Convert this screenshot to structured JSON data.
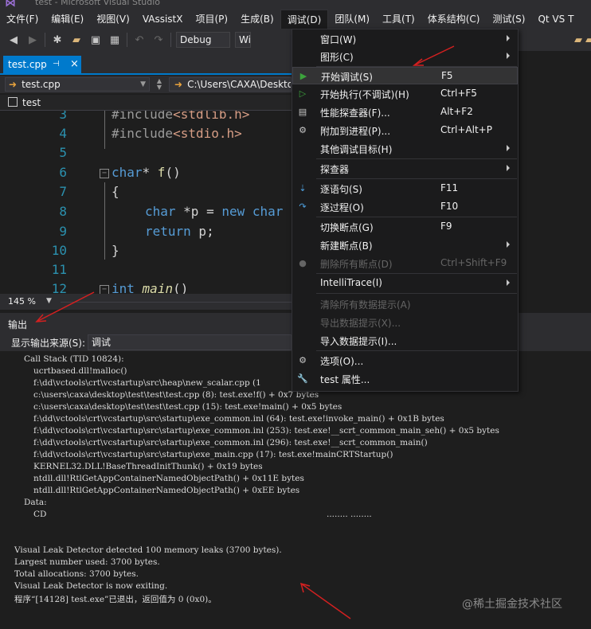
{
  "window": {
    "title": "test - Microsoft Visual Studio"
  },
  "menubar": {
    "items": [
      "文件(F)",
      "编辑(E)",
      "视图(V)",
      "VAssistX",
      "项目(P)",
      "生成(B)",
      "调试(D)",
      "团队(M)",
      "工具(T)",
      "体系结构(C)",
      "测试(S)",
      "Qt VS T"
    ]
  },
  "toolbar": {
    "config": "Debug",
    "platform": "Wi"
  },
  "doc_tab": {
    "label": "test.cpp"
  },
  "navbar": {
    "file": "test.cpp",
    "path": "C:\\Users\\CAXA\\Deskto"
  },
  "scope": {
    "label": "test"
  },
  "editor": {
    "zoom": "145 %",
    "lines": [
      {
        "num": "3",
        "pp": "#include",
        "arg": "<stdlib.h>"
      },
      {
        "num": "4",
        "pp": "#include",
        "arg": "<stdio.h>"
      },
      {
        "num": "5"
      },
      {
        "num": "6",
        "kw": "char",
        "rest": "* ",
        "fn": "f",
        "tail": "()"
      },
      {
        "num": "7",
        "text": "{"
      },
      {
        "num": "8",
        "kw": "char",
        "rest": " *p = ",
        "kw2": "new",
        "tail": " char"
      },
      {
        "num": "9",
        "kw": "return",
        "rest": " p;"
      },
      {
        "num": "10",
        "text": "}"
      },
      {
        "num": "11"
      },
      {
        "num": "12",
        "kw": "int",
        "fn": "main",
        "tail": "()"
      }
    ]
  },
  "output": {
    "title": "输出",
    "source_label": "显示输出来源(S):",
    "source_value": "调试",
    "lines": [
      "Call Stack (TID 10824):",
      "ucrtbased.dll!malloc()",
      "f:\\dd\\vctools\\crt\\vcstartup\\src\\heap\\new_scalar.cpp (1",
      "c:\\users\\caxa\\desktop\\test\\test\\test.cpp (8): test.exe!f() + 0x7 bytes",
      "c:\\users\\caxa\\desktop\\test\\test\\test.cpp (15): test.exe!main() + 0x5 bytes",
      "f:\\dd\\vctools\\crt\\vcstartup\\src\\startup\\exe_common.inl (64): test.exe!invoke_main() + 0x1B bytes",
      "f:\\dd\\vctools\\crt\\vcstartup\\src\\startup\\exe_common.inl (253): test.exe!__scrt_common_main_seh() + 0x5 bytes",
      "f:\\dd\\vctools\\crt\\vcstartup\\src\\startup\\exe_common.inl (296): test.exe!__scrt_common_main()",
      "f:\\dd\\vctools\\crt\\vcstartup\\src\\startup\\exe_main.cpp (17): test.exe!mainCRTStartup()",
      "KERNEL32.DLL!BaseThreadInitThunk() + 0x19 bytes",
      "ntdll.dll!RtlGetAppContainerNamedObjectPath() + 0x11E bytes",
      "ntdll.dll!RtlGetAppContainerNamedObjectPath() + 0xEE bytes",
      "Data:",
      "CD",
      "........ ........",
      "Visual Leak Detector detected 100 memory leaks (3700 bytes).",
      "Largest number used: 3700 bytes.",
      "Total allocations: 3700 bytes.",
      "Visual Leak Detector is now exiting.",
      "程序“[14128] test.exe”已退出，返回值为 0 (0x0)。"
    ]
  },
  "debug_menu": {
    "items": [
      {
        "label": "窗口(W)",
        "shortcut": "",
        "icon": "",
        "submenu": true,
        "disabled": false
      },
      {
        "label": "图形(C)",
        "shortcut": "",
        "icon": "",
        "submenu": true,
        "disabled": false
      },
      {
        "label": "开始调试(S)",
        "shortcut": "F5",
        "icon": "play-icon",
        "submenu": false,
        "disabled": false,
        "hover": true
      },
      {
        "label": "开始执行(不调试)(H)",
        "shortcut": "Ctrl+F5",
        "icon": "play-outline-icon",
        "submenu": false,
        "disabled": false
      },
      {
        "label": "性能探查器(F)...",
        "shortcut": "Alt+F2",
        "icon": "profiler-icon",
        "submenu": false,
        "disabled": false
      },
      {
        "label": "附加到进程(P)...",
        "shortcut": "Ctrl+Alt+P",
        "icon": "attach-icon",
        "submenu": false,
        "disabled": false
      },
      {
        "label": "其他调试目标(H)",
        "shortcut": "",
        "icon": "",
        "submenu": true,
        "disabled": false
      },
      {
        "label": "探查器",
        "shortcut": "",
        "icon": "",
        "submenu": true,
        "disabled": false
      },
      {
        "label": "逐语句(S)",
        "shortcut": "F11",
        "icon": "step-into-icon",
        "submenu": false,
        "disabled": false
      },
      {
        "label": "逐过程(O)",
        "shortcut": "F10",
        "icon": "step-over-icon",
        "submenu": false,
        "disabled": false
      },
      {
        "label": "切换断点(G)",
        "shortcut": "F9",
        "icon": "",
        "submenu": false,
        "disabled": false
      },
      {
        "label": "新建断点(B)",
        "shortcut": "",
        "icon": "",
        "submenu": true,
        "disabled": false
      },
      {
        "label": "删除所有断点(D)",
        "shortcut": "Ctrl+Shift+F9",
        "icon": "delete-breakpoints-icon",
        "submenu": false,
        "disabled": true
      },
      {
        "label": "IntelliTrace(I)",
        "shortcut": "",
        "icon": "",
        "submenu": true,
        "disabled": false
      },
      {
        "label": "清除所有数据提示(A)",
        "shortcut": "",
        "icon": "",
        "submenu": false,
        "disabled": true
      },
      {
        "label": "导出数据提示(X)...",
        "shortcut": "",
        "icon": "",
        "submenu": false,
        "disabled": true
      },
      {
        "label": "导入数据提示(I)...",
        "shortcut": "",
        "icon": "",
        "submenu": false,
        "disabled": false
      },
      {
        "label": "选项(O)...",
        "shortcut": "",
        "icon": "gear-icon",
        "submenu": false,
        "disabled": false
      },
      {
        "label": "test 属性...",
        "shortcut": "",
        "icon": "wrench-icon",
        "submenu": false,
        "disabled": false
      }
    ]
  },
  "watermark": "@稀土掘金技术社区",
  "colors": {
    "accent": "#007acc",
    "annotation": "#d42020"
  }
}
